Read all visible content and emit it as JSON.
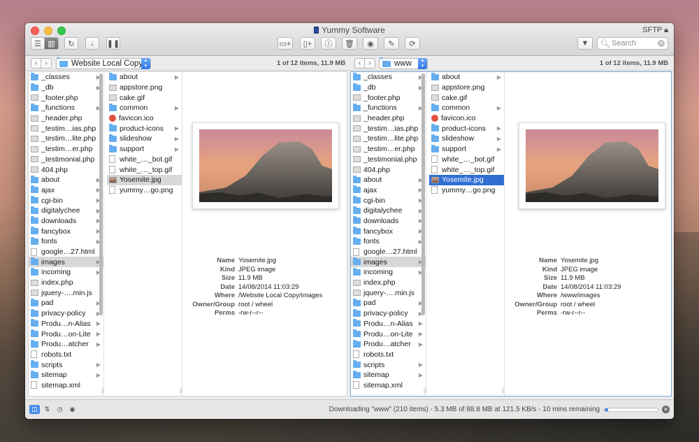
{
  "window": {
    "title": "Yummy Software",
    "protocol": "SFTP"
  },
  "toolbar": {
    "search_placeholder": "Search"
  },
  "left": {
    "path": "Website Local Copy",
    "count": "1 of 12 items, 11.9 MB",
    "col1": [
      {
        "name": "_classes",
        "t": "folder",
        "c": true
      },
      {
        "name": "_db",
        "t": "folder",
        "c": true
      },
      {
        "name": "_footer.php",
        "t": "php",
        "c": false
      },
      {
        "name": "_functions",
        "t": "folder",
        "c": true
      },
      {
        "name": "_header.php",
        "t": "php",
        "c": false
      },
      {
        "name": "_testim…ias.php",
        "t": "php",
        "c": false
      },
      {
        "name": "_testim…lite.php",
        "t": "php",
        "c": false
      },
      {
        "name": "_testim…er.php",
        "t": "php",
        "c": false
      },
      {
        "name": "_testimonial.php",
        "t": "php",
        "c": false
      },
      {
        "name": "404.php",
        "t": "php",
        "c": false
      },
      {
        "name": "about",
        "t": "folder",
        "c": true
      },
      {
        "name": "ajax",
        "t": "folder",
        "c": true
      },
      {
        "name": "cgi-bin",
        "t": "folder",
        "c": true
      },
      {
        "name": "digitalychee",
        "t": "folder",
        "c": true
      },
      {
        "name": "downloads",
        "t": "folder",
        "c": true
      },
      {
        "name": "fancybox",
        "t": "folder",
        "c": true
      },
      {
        "name": "fonts",
        "t": "folder",
        "c": true
      },
      {
        "name": "google…27.html",
        "t": "file",
        "c": false
      },
      {
        "name": "images",
        "t": "folder",
        "c": true,
        "sel": "gray"
      },
      {
        "name": "incoming",
        "t": "folder",
        "c": true
      },
      {
        "name": "index.php",
        "t": "php",
        "c": false
      },
      {
        "name": "jquery-….min.js",
        "t": "php",
        "c": false
      },
      {
        "name": "pad",
        "t": "folder",
        "c": true
      },
      {
        "name": "privacy-policy",
        "t": "folder",
        "c": true
      },
      {
        "name": "Produ…n-Alias",
        "t": "folder",
        "c": true
      },
      {
        "name": "Produ…on-Lite",
        "t": "folder",
        "c": true
      },
      {
        "name": "Produ…atcher",
        "t": "folder",
        "c": true
      },
      {
        "name": "robots.txt",
        "t": "file",
        "c": false
      },
      {
        "name": "scripts",
        "t": "folder",
        "c": true
      },
      {
        "name": "sitemap",
        "t": "folder",
        "c": true
      },
      {
        "name": "sitemap.xml",
        "t": "file",
        "c": false
      }
    ],
    "col2": [
      {
        "name": "about",
        "t": "folder",
        "c": true
      },
      {
        "name": "appstore.png",
        "t": "php",
        "c": false
      },
      {
        "name": "cake.gif",
        "t": "php",
        "c": false
      },
      {
        "name": "common",
        "t": "folder",
        "c": true
      },
      {
        "name": "favicon.ico",
        "t": "red",
        "c": false
      },
      {
        "name": "product-icons",
        "t": "folder",
        "c": true
      },
      {
        "name": "slideshow",
        "t": "folder",
        "c": true
      },
      {
        "name": "support",
        "t": "folder",
        "c": true
      },
      {
        "name": "white_…_bot.gif",
        "t": "file",
        "c": false
      },
      {
        "name": "white_…_top.gif",
        "t": "file",
        "c": false
      },
      {
        "name": "Yosemite.jpg",
        "t": "img",
        "c": false,
        "sel": "gray"
      },
      {
        "name": "yummy…go.png",
        "t": "file",
        "c": false
      }
    ],
    "info": {
      "Name": "Yosemite.jpg",
      "Kind": "JPEG image",
      "Size": "11.9 MB",
      "Date": "14/08/2014 11:03:29",
      "Where": "/Website Local Copy/images",
      "Owner/Group": "root / wheel",
      "Perms": "-rw-r--r--"
    }
  },
  "right": {
    "path": "www",
    "count": "1 of 12 items, 11.9 MB",
    "col2_selected": "Yosemite.jpg",
    "info": {
      "Name": "Yosemite.jpg",
      "Kind": "JPEG image",
      "Size": "11.9 MB",
      "Date": "14/08/2014 11:03:29",
      "Where": "/www/images",
      "Owner/Group": "root / wheel",
      "Perms": "-rw-r--r--"
    }
  },
  "status": {
    "text": "Downloading \"www\" (210 items) - 5.3 MB of 88.8 MB at 121.5 KB/s  -  10 mins remaining",
    "progress_fraction": 0.06
  },
  "colors": {
    "accent": "#2f6fd4",
    "folder": "#65aef0"
  }
}
